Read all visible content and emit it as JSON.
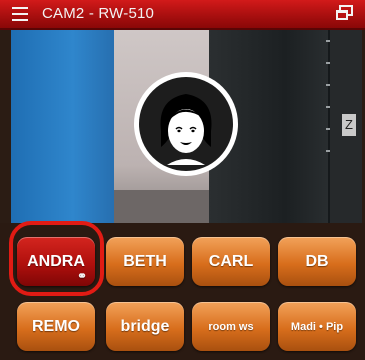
{
  "titlebar": {
    "title": "CAM2 - RW-510",
    "menu_icon": "hamburger-menu-icon",
    "window_icon": "restore-window-icon"
  },
  "video": {
    "overlay_letter": "Z",
    "avatar_icon": "person-avatar-icon"
  },
  "presets": [
    {
      "label": "ANDRA",
      "active": true,
      "linked": true
    },
    {
      "label": "BETH",
      "active": false
    },
    {
      "label": "CARL",
      "active": false
    },
    {
      "label": "DB",
      "active": false
    },
    {
      "label": "REMO",
      "active": false
    },
    {
      "label": "bridge",
      "active": false
    },
    {
      "label": "room ws",
      "active": false
    },
    {
      "label": "Madi • Pip",
      "active": false
    }
  ],
  "link_glyph": "⚭",
  "colors": {
    "titlebar": "#b81212",
    "button_orange": "#d86e1c",
    "button_active": "#b0100d",
    "highlight_ring": "#e11b14"
  }
}
